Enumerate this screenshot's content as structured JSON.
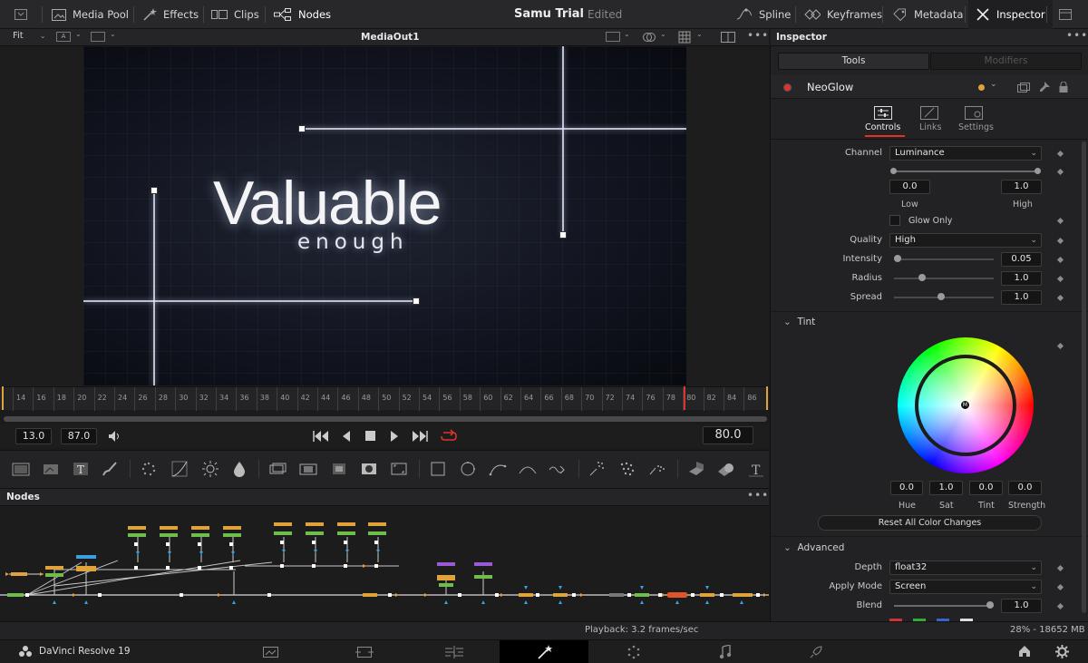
{
  "topbar": {
    "media_pool": "Media Pool",
    "effects": "Effects",
    "clips": "Clips",
    "nodes": "Nodes",
    "title": "Samu Trial",
    "status": "Edited",
    "spline": "Spline",
    "keyframes": "Keyframes",
    "metadata": "Metadata",
    "inspector": "Inspector"
  },
  "viewer": {
    "fit": "Fit",
    "name": "MediaOut1",
    "text_main": "Valuable",
    "text_sub": "enough"
  },
  "ruler": {
    "ticks": [
      "14",
      "16",
      "18",
      "20",
      "22",
      "24",
      "26",
      "28",
      "30",
      "32",
      "34",
      "36",
      "38",
      "40",
      "42",
      "44",
      "46",
      "48",
      "50",
      "52",
      "54",
      "56",
      "58",
      "60",
      "62",
      "64",
      "66",
      "68",
      "70",
      "72",
      "74",
      "76",
      "78",
      "80",
      "82",
      "84",
      "86"
    ]
  },
  "transport": {
    "start": "13.0",
    "end": "87.0",
    "current": "80.0"
  },
  "nodes_panel": {
    "title": "Nodes"
  },
  "status": {
    "playback": "Playback: 3.2 frames/sec",
    "memory": "28% - 18652 MB"
  },
  "bottombar": {
    "app": "DaVinci Resolve 19"
  },
  "inspector": {
    "title": "Inspector",
    "tab_tools": "Tools",
    "tab_modifiers": "Modifiers",
    "node_name": "NeoGlow",
    "subtab_controls": "Controls",
    "subtab_links": "Links",
    "subtab_settings": "Settings",
    "channel_label": "Channel",
    "channel_value": "Luminance",
    "low_value": "0.0",
    "high_value": "1.0",
    "low_label": "Low",
    "high_label": "High",
    "glow_only": "Glow Only",
    "quality_label": "Quality",
    "quality_value": "High",
    "intensity_label": "Intensity",
    "intensity_value": "0.05",
    "radius_label": "Radius",
    "radius_value": "1.0",
    "spread_label": "Spread",
    "spread_value": "1.0",
    "tint_label": "Tint",
    "hue_value": "0.0",
    "sat_value": "1.0",
    "tint_value": "0.0",
    "strength_value": "0.0",
    "hue_label": "Hue",
    "sat_label": "Sat",
    "tint_col_label": "Tint",
    "strength_label": "Strength",
    "reset_label": "Reset All Color Changes",
    "advanced_label": "Advanced",
    "depth_label": "Depth",
    "depth_value": "float32",
    "apply_label": "Apply Mode",
    "apply_value": "Screen",
    "blend_label": "Blend",
    "blend_value": "1.0"
  },
  "colors": {
    "accent_red": "#e0312b",
    "node_orange": "#e0a23a",
    "node_green": "#6fbd4a",
    "node_purple": "#9b59d6",
    "node_blue": "#3aa0e0"
  }
}
